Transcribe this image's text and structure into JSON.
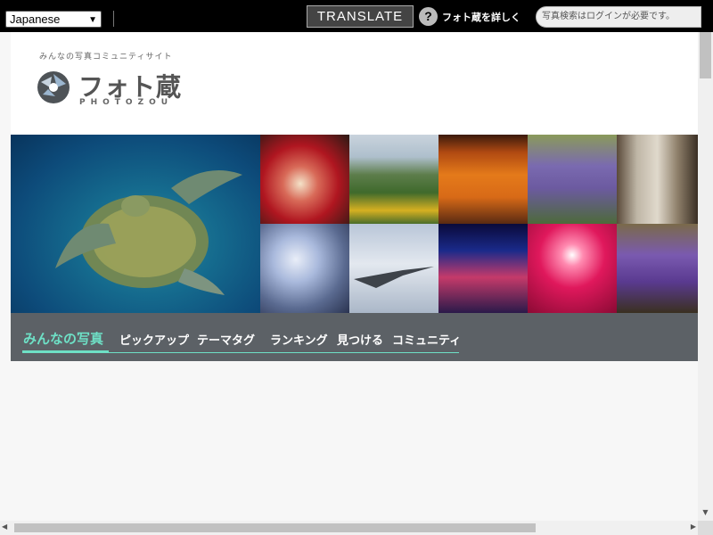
{
  "translate_bar": {
    "language": "Japanese",
    "translate_label": "TRANSLATE",
    "help_link": "フォト蔵を詳しく",
    "search_placeholder": "写真検索はログインが必要です。"
  },
  "header": {
    "tagline": "みんなの写真コミュニティサイト",
    "logo_text": "フォト蔵",
    "logo_sub": "PHOTOZOU"
  },
  "nav": {
    "items": [
      {
        "label": "みんなの写真",
        "active": true
      },
      {
        "label": "ピックアップ"
      },
      {
        "label": "テーマタグ"
      },
      {
        "label": "ランキング"
      },
      {
        "label": "見つける"
      },
      {
        "label": "コミュニティ"
      }
    ]
  },
  "mosaic": {
    "photos": [
      "sea-turtle-photo",
      "dahlia-photo",
      "sunflowers-photo",
      "sunset-birds-photo",
      "lavender-photo",
      "snails-on-stump-photo",
      "nemophila-photo",
      "jet-fighter-photo",
      "city-night-photo",
      "pink-light-photo",
      "purple-flowers-photo"
    ]
  },
  "colors": {
    "accent": "#6ee0c6",
    "nav_bg": "#5c6166",
    "topbar_bg": "#000000"
  }
}
